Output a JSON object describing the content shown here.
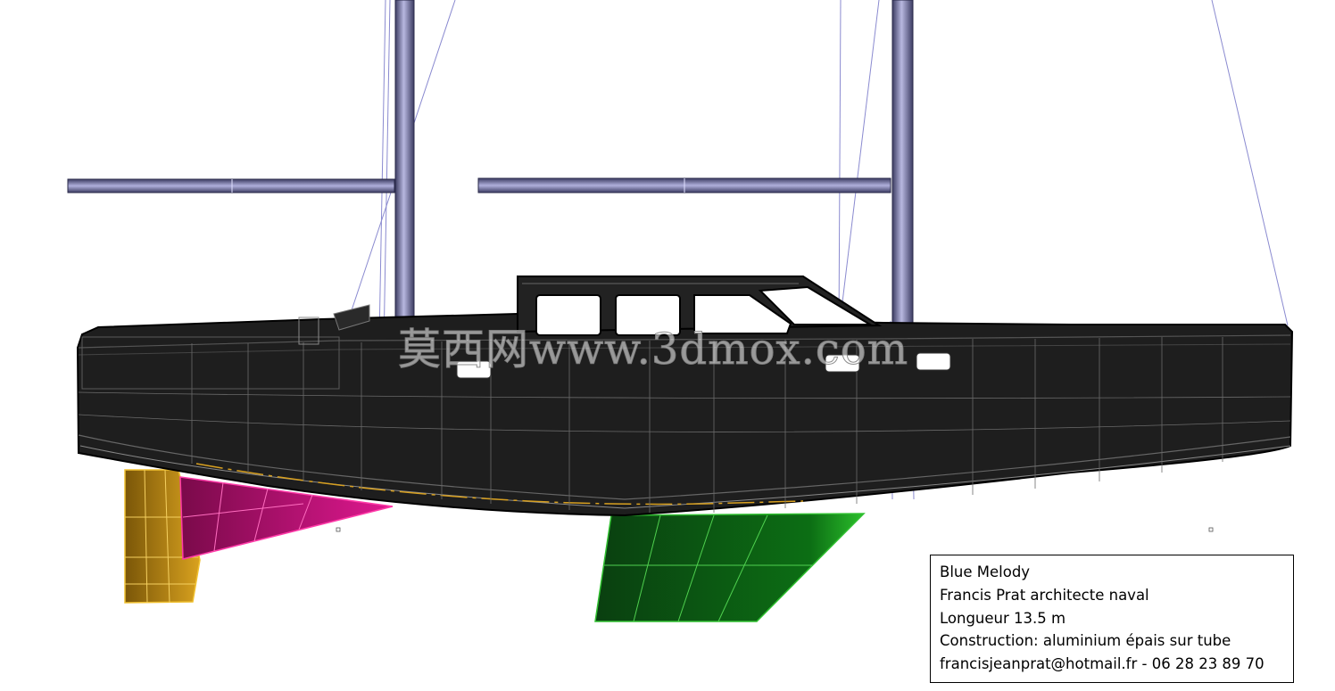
{
  "title_block": {
    "boat_name": "Blue Melody",
    "designer": "Francis Prat architecte naval",
    "length": "Longueur 13.5 m",
    "construction": "Construction: aluminium épais sur tube",
    "contact": "francisjeanprat@hotmail.fr - 06 28 23 89 70"
  },
  "watermark": "莫西网www.3dmox.com",
  "colors": {
    "hull": "#1c1c1c",
    "mast": "#5a5a8c",
    "rudder": "#c8921a",
    "skeg": "#a01060",
    "keel": "#0b7a12",
    "rigging": "#8a8ad0"
  },
  "icons": [
    "sailboat-hull-drawing",
    "mast",
    "boom",
    "keel",
    "rudder",
    "skeg"
  ]
}
